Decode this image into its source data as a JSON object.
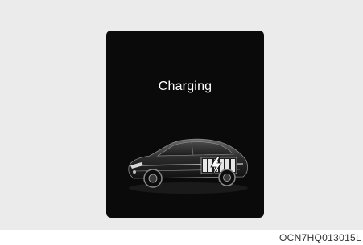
{
  "display": {
    "status_text": "Charging",
    "icon": "ev-charging-car-icon"
  },
  "figure": {
    "code": "OCN7HQ013015L"
  },
  "colors": {
    "screen_background": "#0a0a0a",
    "page_background": "#ebebeb",
    "text": "#ffffff"
  }
}
